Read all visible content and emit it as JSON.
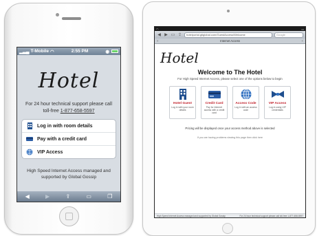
{
  "iphone": {
    "status": {
      "carrier": "T-Mobile",
      "time": "2:55 PM"
    },
    "logo": "Hotel",
    "support": {
      "text": "For 24 hour technical support please call toll-free",
      "phone": "1-877-658-5597"
    },
    "menu": [
      {
        "label": "Log in with room details",
        "icon": "hotel-building-icon"
      },
      {
        "label": "Pay with a credit card",
        "icon": "credit-card-icon"
      },
      {
        "label": "VIP Access",
        "icon": "globe-icon"
      }
    ],
    "footer": "High Speed Internet Access managed and supported by Global Gossip"
  },
  "ipad": {
    "logo": "Hotel",
    "welcome": "Welcome to The Hotel",
    "subtitle": "For High Speed Internet Access, please select one of the options below to begin",
    "tab_title": "Internet Access",
    "url": "hotelportal.gtiglobal.com/GuestAccess/Welcome",
    "search_placeholder": "Google",
    "cards": [
      {
        "title": "Hotel Guest",
        "desc": "Log in with your room details",
        "icon": "hotel-building-icon"
      },
      {
        "title": "Credit Card",
        "desc": "Pay for Internet access with a credit card",
        "icon": "credit-card-icon"
      },
      {
        "title": "Access Code",
        "desc": "Log in with an access code",
        "icon": "globe-icon"
      },
      {
        "title": "VIP Access",
        "desc": "Log in using VIP credentials",
        "icon": "bowtie-icon"
      }
    ],
    "pricing": "Pricing will be displayed once your access method above is selected",
    "problems": "If you are having problems viewing this page then click here",
    "footer_left": "High Speed Internet Access managed and supported by Global Gossip",
    "footer_right": "For 24 hour technical support please call toll-free 1-877-658-5597"
  },
  "colors": {
    "accent_red": "#c0202a",
    "toolbar_blue": "#6c7d90"
  }
}
